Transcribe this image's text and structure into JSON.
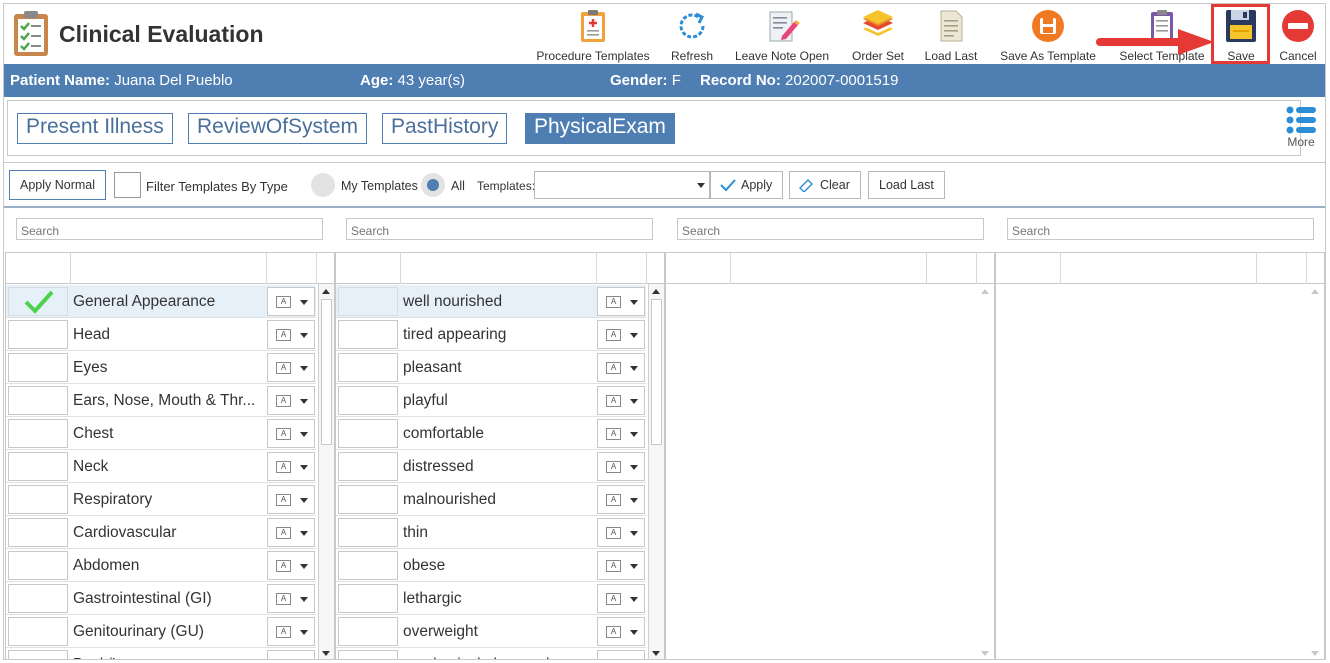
{
  "app": {
    "title": "Clinical Evaluation"
  },
  "toolbar": [
    {
      "label": "Procedure Templates",
      "icon": "clipboard-plus-icon"
    },
    {
      "label": "Refresh",
      "icon": "refresh-icon"
    },
    {
      "label": "Leave Note Open",
      "icon": "note-pencil-icon"
    },
    {
      "label": "Order Set",
      "icon": "layers-icon"
    },
    {
      "label": "Load Last",
      "icon": "document-icon"
    },
    {
      "label": "Save As Template",
      "icon": "save-circle-icon"
    },
    {
      "label": "Select Template",
      "icon": "template-list-icon"
    },
    {
      "label": "Save",
      "icon": "floppy-disk-icon"
    },
    {
      "label": "Cancel",
      "icon": "cancel-circle-icon"
    }
  ],
  "patient": {
    "name_label": "Patient Name:",
    "name": "Juana Del Pueblo",
    "age_label": "Age:",
    "age": "43 year(s)",
    "gender_label": "Gender:",
    "gender": "F",
    "record_label": "Record No:",
    "record": "202007-0001519"
  },
  "tabs": [
    {
      "label": "Present Illness",
      "active": false
    },
    {
      "label": "ReviewOfSystem",
      "active": false
    },
    {
      "label": "PastHistory",
      "active": false
    },
    {
      "label": "PhysicalExam",
      "active": true
    }
  ],
  "more_label": "More",
  "filters": {
    "apply_normal": "Apply Normal",
    "filter_by_type": "Filter Templates By Type",
    "my_templates": "My Templates",
    "all": "All",
    "templates_label": "Templates:",
    "apply": "Apply",
    "clear": "Clear",
    "load_last": "Load Last"
  },
  "search_placeholder": "Search",
  "systems": [
    {
      "label": "General Appearance",
      "checked": true
    },
    {
      "label": "Head",
      "checked": false
    },
    {
      "label": "Eyes",
      "checked": false
    },
    {
      "label": "Ears, Nose, Mouth & Thr...",
      "checked": false
    },
    {
      "label": "Chest",
      "checked": false
    },
    {
      "label": "Neck",
      "checked": false
    },
    {
      "label": "Respiratory",
      "checked": false
    },
    {
      "label": "Cardiovascular",
      "checked": false
    },
    {
      "label": "Abdomen",
      "checked": false
    },
    {
      "label": "Gastrointestinal (GI)",
      "checked": false
    },
    {
      "label": "Genitourinary (GU)",
      "checked": false
    },
    {
      "label": "Back/Lum...",
      "checked": false
    }
  ],
  "findings": [
    {
      "label": "well nourished"
    },
    {
      "label": "tired appearing"
    },
    {
      "label": "pleasant"
    },
    {
      "label": "playful"
    },
    {
      "label": "comfortable"
    },
    {
      "label": "distressed"
    },
    {
      "label": "malnourished"
    },
    {
      "label": "thin"
    },
    {
      "label": "obese"
    },
    {
      "label": "lethargic"
    },
    {
      "label": "overweight"
    },
    {
      "label": "no physical abnormal..."
    }
  ],
  "colors": {
    "accent": "#4f7eb3",
    "highlight": "#e53935",
    "check": "#4cd24c"
  }
}
